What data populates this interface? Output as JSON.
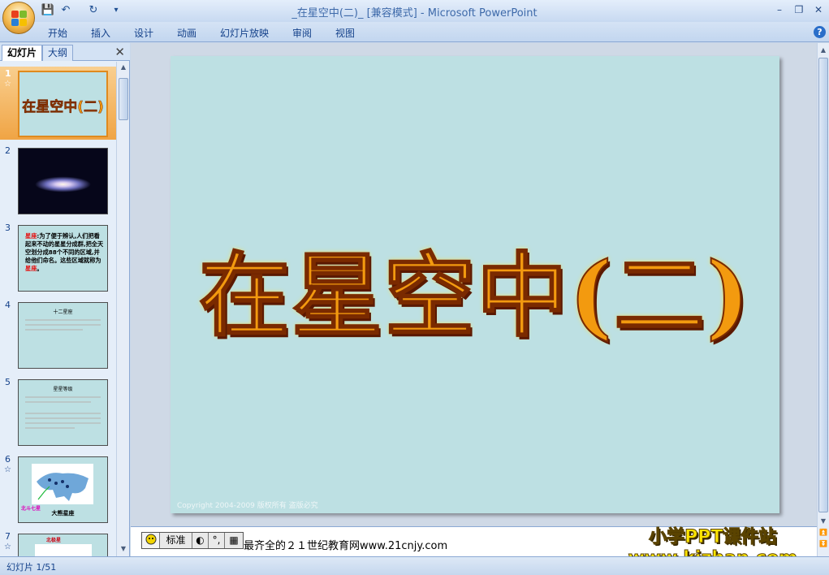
{
  "window": {
    "title": "_在星空中(二)_ [兼容模式] - Microsoft PowerPoint",
    "minimize_glyph": "–",
    "restore_glyph": "❐",
    "close_glyph": "✕"
  },
  "quick_access": {
    "save_glyph": "💾",
    "undo_glyph": "↶",
    "redo_glyph": "↻",
    "more_glyph": "▾"
  },
  "ribbon": {
    "tabs": [
      "开始",
      "插入",
      "设计",
      "动画",
      "幻灯片放映",
      "审阅",
      "视图"
    ],
    "help_glyph": "?"
  },
  "left_pane": {
    "tab_slides": "幻灯片",
    "tab_outline": "大纲",
    "close_glyph": "✕",
    "animation_glyph": "☆",
    "slides": [
      {
        "num": "1",
        "title": "在星空中(二)",
        "has_animation": true
      },
      {
        "num": "2"
      },
      {
        "num": "3",
        "lead": "星座",
        "text": ":为了便于辨认,人们把看起来不动的星星分成群,把全天空划分成88个不同的区域,并给他们命名。这些区域就称为",
        "tail": "星座",
        "end": "。"
      },
      {
        "num": "4",
        "heading": "十二星座"
      },
      {
        "num": "5",
        "heading": "星星等级"
      },
      {
        "num": "6",
        "caption": "大熊星座",
        "label": "北斗七星",
        "has_animation": true
      },
      {
        "num": "7",
        "label": "北极星",
        "has_animation": true
      }
    ]
  },
  "slide": {
    "title": "在星空中(二)",
    "copyright": "Copyright 2004-2009 版权所有 盗版必究"
  },
  "notes_bar": {
    "ime_mode": "标准",
    "text": "最齐全的２１世纪教育网www.21cnjy.com"
  },
  "watermark": {
    "line1": "小学PPT课件站",
    "line2": "www.kjzhan.com"
  },
  "status": {
    "slide_position": "幻灯片 1/51"
  },
  "colors": {
    "slide_background": "#bde0e3",
    "title_fill": "#f39a0f",
    "selection": "#f0a444"
  }
}
